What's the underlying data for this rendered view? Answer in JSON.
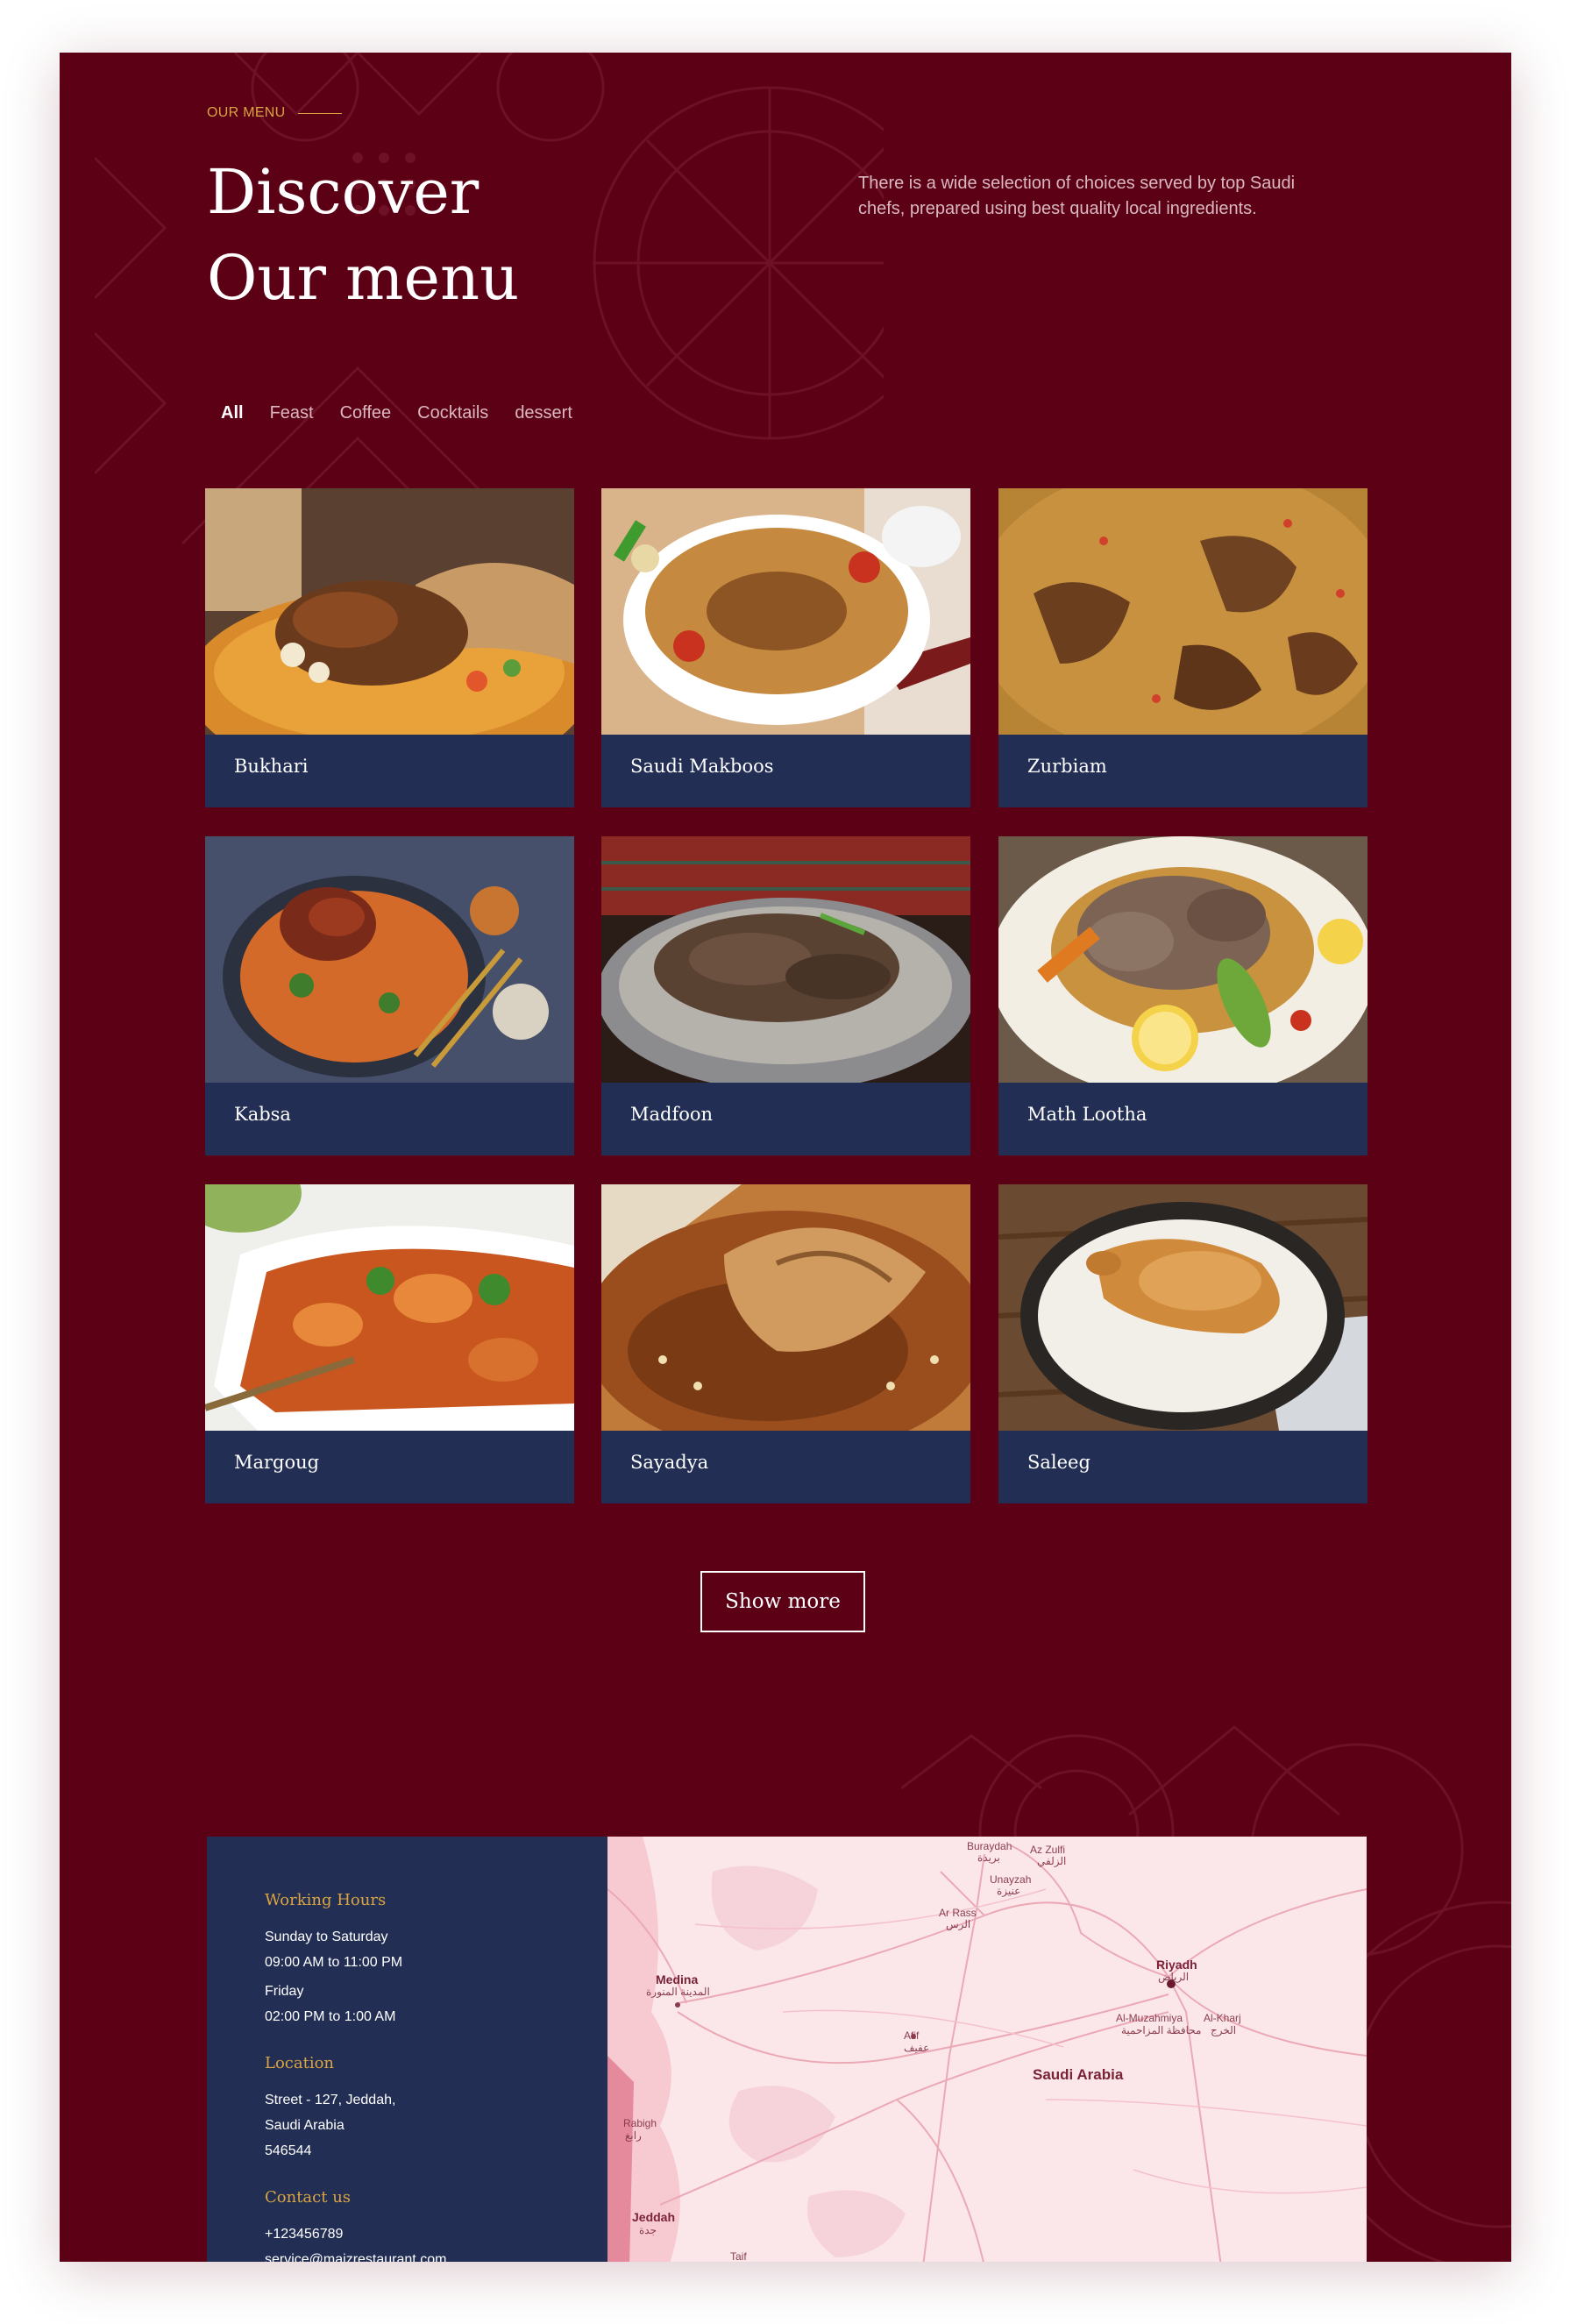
{
  "menu_section": {
    "eyebrow": "OUR MENU",
    "title_line1": "Discover",
    "title_line2": "Our menu",
    "intro": "There is a wide selection of choices served by top Saudi chefs, prepared using best quality local ingredients."
  },
  "tabs": [
    {
      "label": "All",
      "active": true
    },
    {
      "label": "Feast",
      "active": false
    },
    {
      "label": "Coffee",
      "active": false
    },
    {
      "label": "Cocktails",
      "active": false
    },
    {
      "label": "dessert",
      "active": false
    }
  ],
  "dishes": [
    {
      "name": "Bukhari"
    },
    {
      "name": "Saudi Makboos"
    },
    {
      "name": "Zurbiam"
    },
    {
      "name": "Kabsa"
    },
    {
      "name": "Madfoon"
    },
    {
      "name": "Math Lootha"
    },
    {
      "name": "Margoug"
    },
    {
      "name": "Sayadya"
    },
    {
      "name": "Saleeg"
    }
  ],
  "show_more_label": "Show more",
  "info": {
    "working_hours_title": "Working Hours",
    "weekday_days": "Sunday to Saturday",
    "weekday_hours": "09:00 AM to 11:00 PM",
    "friday_day": "Friday",
    "friday_hours": "02:00 PM to 1:00 AM",
    "location_title": "Location",
    "address_line1": "Street - 127, Jeddah,",
    "address_line2": "Saudi Arabia",
    "address_line3": "546544",
    "contact_title": "Contact us",
    "phone": "+123456789",
    "email": "service@maizrestaurant.com"
  },
  "map_labels": {
    "buraydah": "Buraydah",
    "buraydah_ar": "بريدة",
    "az_zulfi": "Az Zulfi",
    "az_zulfi_ar": "الزلفي",
    "unayzah": "Unayzah",
    "unayzah_ar": "عنيزة",
    "ar_rass": "Ar Rass",
    "ar_rass_ar": "الرس",
    "medina": "Medina",
    "medina_ar": "المدينة المنورة",
    "riyadh": "Riyadh",
    "riyadh_ar": "الرياض",
    "al_muzahmiya": "Al-Muzahmiya",
    "al_muzahmiya_ar": "محافظة المزاحمية",
    "al_kharj": "Al-Kharj",
    "al_kharj_ar": "الخرج",
    "afif": "Afif",
    "afif_ar": "عفيف",
    "country": "Saudi Arabia",
    "rabigh": "Rabigh",
    "rabigh_ar": "رابغ",
    "jeddah": "Jeddah",
    "jeddah_ar": "جدة",
    "taif": "Taif"
  },
  "colors": {
    "page_background": "#5c0016",
    "card_background": "#222e54",
    "accent_gold": "#d9a441",
    "map_background": "#fbe7ea"
  }
}
